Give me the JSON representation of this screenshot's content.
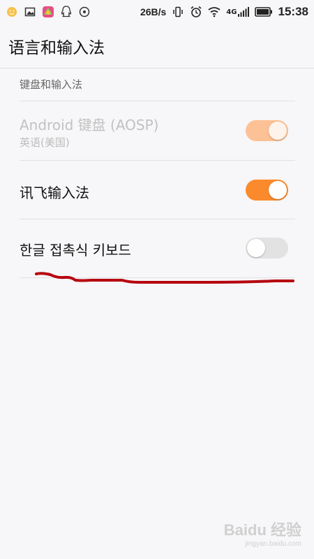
{
  "status_bar": {
    "net_speed": "26B/s",
    "network_label": "4G",
    "time": "15:38",
    "icons_left": [
      "emoji-icon",
      "gallery-icon",
      "colorful-app-icon",
      "qq-icon",
      "music-icon"
    ],
    "icons_right": [
      "vibrate-icon",
      "alarm-icon",
      "wifi-icon",
      "signal-icon",
      "battery-icon"
    ]
  },
  "header": {
    "title": "语言和输入法"
  },
  "section": {
    "label": "键盘和输入法"
  },
  "keyboards": [
    {
      "name": "Android 键盘 (AOSP)",
      "subtitle": "英语(美国)",
      "enabled": true,
      "disabled_row": true
    },
    {
      "name": "讯飞输入法",
      "enabled": true,
      "disabled_row": false
    },
    {
      "name": "한글 접촉식 키보드",
      "enabled": false,
      "disabled_row": false
    }
  ],
  "colors": {
    "accent": "#fb8a2c",
    "accent_dim": "#fcc195",
    "annotation": "#b5050f"
  },
  "watermark": {
    "main": "Baidu 经验",
    "sub": "jingyan.baidu.com"
  }
}
